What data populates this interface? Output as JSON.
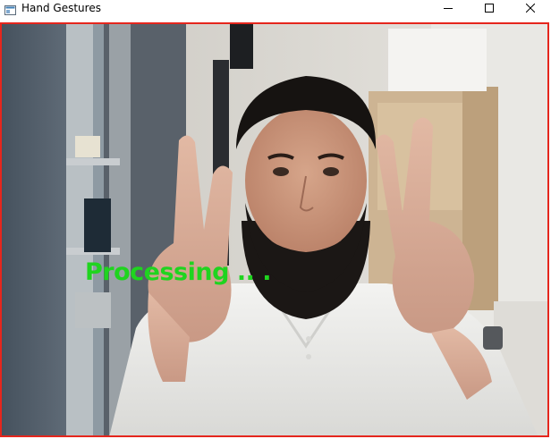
{
  "window": {
    "title": "Hand Gestures",
    "app_icon": "opencv-window-icon"
  },
  "controls": {
    "minimize_icon": "minimize-icon",
    "maximize_icon": "maximize-icon",
    "close_icon": "close-icon"
  },
  "feed": {
    "status_text": "Processing .. .",
    "status_color": "#1fd41f",
    "border_color": "#e5261d"
  }
}
